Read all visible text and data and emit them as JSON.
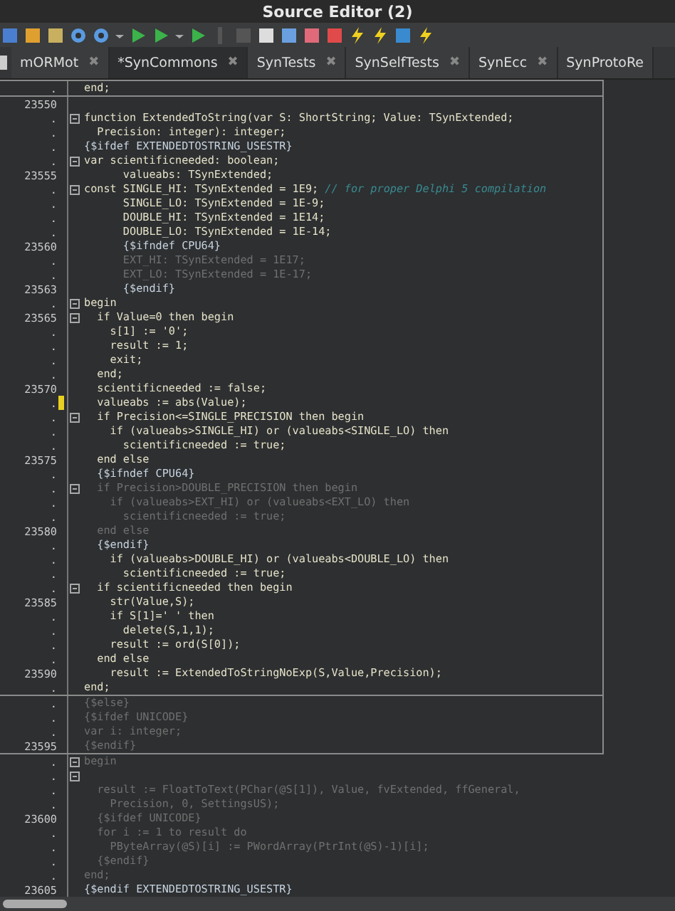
{
  "window": {
    "title": "Source Editor (2)"
  },
  "tabs": [
    {
      "label": "mORMot",
      "selected": false,
      "closable": true
    },
    {
      "label": "*SynCommons",
      "selected": true,
      "closable": true
    },
    {
      "label": "SynTests",
      "selected": false,
      "closable": true
    },
    {
      "label": "SynSelfTests",
      "selected": false,
      "closable": true
    },
    {
      "label": "SynEcc",
      "selected": false,
      "closable": true
    },
    {
      "label": "SynProtoRe",
      "selected": false,
      "closable": false
    }
  ],
  "tab_close_glyph": "✖",
  "blocks": [
    {
      "framed": true,
      "lines": [
        {
          "number": ".",
          "kind": "code",
          "text": "end;",
          "fold": false
        }
      ]
    },
    {
      "framed": true,
      "lines": [
        {
          "number": "23550",
          "fold": false
        },
        {
          "number": ".",
          "kind": "code",
          "text": "function ExtendedToString(var S: ShortString; Value: TSynExtended;",
          "fold": true
        },
        {
          "number": ".",
          "kind": "code",
          "text": "  Precision: integer): integer;",
          "fold": false
        },
        {
          "number": ".",
          "kind": "directive",
          "text": "{$ifdef EXTENDEDTOSTRING_USESTR}",
          "fold": false
        },
        {
          "number": ".",
          "kind": "code",
          "text": "var scientificneeded: boolean;",
          "fold": true
        },
        {
          "number": "23555",
          "kind": "code",
          "text": "      valueabs: TSynExtended;",
          "fold": false
        },
        {
          "number": ".",
          "kind": "code",
          "text": "const SINGLE_HI: TSynExtended = 1E9; ",
          "comment": "// for proper Delphi 5 compilation",
          "fold": true
        },
        {
          "number": ".",
          "kind": "code",
          "text": "      SINGLE_LO: TSynExtended = 1E-9;",
          "fold": false
        },
        {
          "number": ".",
          "kind": "code",
          "text": "      DOUBLE_HI: TSynExtended = 1E14;",
          "fold": false
        },
        {
          "number": ".",
          "kind": "code",
          "text": "      DOUBLE_LO: TSynExtended = 1E-14;",
          "fold": false
        },
        {
          "number": "23560",
          "kind": "directive",
          "text": "      {$ifndef CPU64}",
          "fold": false
        },
        {
          "number": ".",
          "kind": "inactive",
          "text": "      EXT_HI: TSynExtended = 1E17;",
          "fold": false
        },
        {
          "number": ".",
          "kind": "inactive",
          "text": "      EXT_LO: TSynExtended = 1E-17;",
          "fold": false
        },
        {
          "number": "23563",
          "kind": "directive",
          "text": "      {$endif}",
          "fold": false
        },
        {
          "number": ".",
          "kind": "code",
          "text": "begin",
          "fold": true
        },
        {
          "number": "23565",
          "kind": "code",
          "text": "  if Value=0 then begin",
          "fold": true
        },
        {
          "number": ".",
          "kind": "code",
          "text": "    s[1] := '0';",
          "fold": false
        },
        {
          "number": ".",
          "kind": "code",
          "text": "    result := 1;",
          "fold": false
        },
        {
          "number": ".",
          "kind": "code",
          "text": "    exit;",
          "fold": false
        },
        {
          "number": ".",
          "kind": "code",
          "text": "  end;",
          "fold": false
        },
        {
          "number": "23570",
          "kind": "code",
          "text": "  scientificneeded := false;",
          "fold": false
        },
        {
          "number": ".",
          "kind": "code",
          "text": "  valueabs := abs(Value);",
          "fold": false,
          "modified": true
        },
        {
          "number": ".",
          "kind": "code",
          "text": "  if Precision<=SINGLE_PRECISION then begin",
          "fold": true
        },
        {
          "number": ".",
          "kind": "code",
          "text": "    if (valueabs>SINGLE_HI) or (valueabs<SINGLE_LO) then",
          "fold": false
        },
        {
          "number": ".",
          "kind": "code",
          "text": "      scientificneeded := true;",
          "fold": false
        },
        {
          "number": "23575",
          "kind": "code",
          "text": "  end else",
          "fold": false
        },
        {
          "number": ".",
          "kind": "directive",
          "text": "  {$ifndef CPU64}",
          "fold": false
        },
        {
          "number": ".",
          "kind": "inactive",
          "text": "  if Precision>DOUBLE_PRECISION then begin",
          "fold": true
        },
        {
          "number": ".",
          "kind": "inactive",
          "text": "    if (valueabs>EXT_HI) or (valueabs<EXT_LO) then",
          "fold": false
        },
        {
          "number": ".",
          "kind": "inactive",
          "text": "      scientificneeded := true;",
          "fold": false
        },
        {
          "number": "23580",
          "kind": "inactive",
          "text": "  end else",
          "fold": false
        },
        {
          "number": ".",
          "kind": "directive",
          "text": "  {$endif}",
          "fold": false
        },
        {
          "number": ".",
          "kind": "code",
          "text": "    if (valueabs>DOUBLE_HI) or (valueabs<DOUBLE_LO) then",
          "fold": false
        },
        {
          "number": ".",
          "kind": "code",
          "text": "      scientificneeded := true;",
          "fold": false
        },
        {
          "number": ".",
          "kind": "code",
          "text": "  if scientificneeded then begin",
          "fold": true
        },
        {
          "number": "23585",
          "kind": "code",
          "text": "    str(Value,S);",
          "fold": false
        },
        {
          "number": ".",
          "kind": "code",
          "text": "    if S[1]=' ' then",
          "fold": false
        },
        {
          "number": ".",
          "kind": "code",
          "text": "      delete(S,1,1);",
          "fold": false
        },
        {
          "number": ".",
          "kind": "code",
          "text": "    result := ord(S[0]);",
          "fold": false
        },
        {
          "number": ".",
          "kind": "code",
          "text": "  end else",
          "fold": false
        },
        {
          "number": "23590",
          "kind": "code",
          "text": "    result := ExtendedToStringNoExp(S,Value,Precision);",
          "fold": false
        },
        {
          "number": ".",
          "kind": "code",
          "text": "end;",
          "fold": false
        }
      ]
    },
    {
      "framed": true,
      "lines": [
        {
          "number": ".",
          "kind": "inactive",
          "text": "{$else}",
          "fold": false
        },
        {
          "number": ".",
          "kind": "inactive",
          "text": "{$ifdef UNICODE}",
          "fold": false
        },
        {
          "number": ".",
          "kind": "inactive",
          "text": "var i: integer;",
          "fold": false
        },
        {
          "number": "23595",
          "kind": "inactive",
          "text": "{$endif}",
          "fold": false
        }
      ]
    },
    {
      "framed": false,
      "lines": [
        {
          "number": ".",
          "kind": "inactive",
          "text": "begin",
          "fold": true
        },
        {
          "number": ".",
          "fold": true
        },
        {
          "number": ".",
          "kind": "inactive",
          "text": "  result := FloatToText(PChar(@S[1]), Value, fvExtended, ffGeneral,",
          "fold": false
        },
        {
          "number": ".",
          "kind": "inactive",
          "text": "    Precision, 0, SettingsUS);",
          "fold": false
        },
        {
          "number": "23600",
          "kind": "inactive",
          "text": "  {$ifdef UNICODE}",
          "fold": false
        },
        {
          "number": ".",
          "kind": "inactive",
          "text": "  for i := 1 to result do",
          "fold": false
        },
        {
          "number": ".",
          "kind": "inactive",
          "text": "    PByteArray(@S)[i] := PWordArray(PtrInt(@S)-1)[i];",
          "fold": false
        },
        {
          "number": ".",
          "kind": "inactive",
          "text": "  {$endif}",
          "fold": false
        },
        {
          "number": ".",
          "kind": "inactive",
          "text": "end;",
          "fold": false
        },
        {
          "number": "23605",
          "kind": "directive",
          "text": "{$endif EXTENDEDTOSTRING_USESTR}",
          "fold": false
        }
      ]
    }
  ]
}
